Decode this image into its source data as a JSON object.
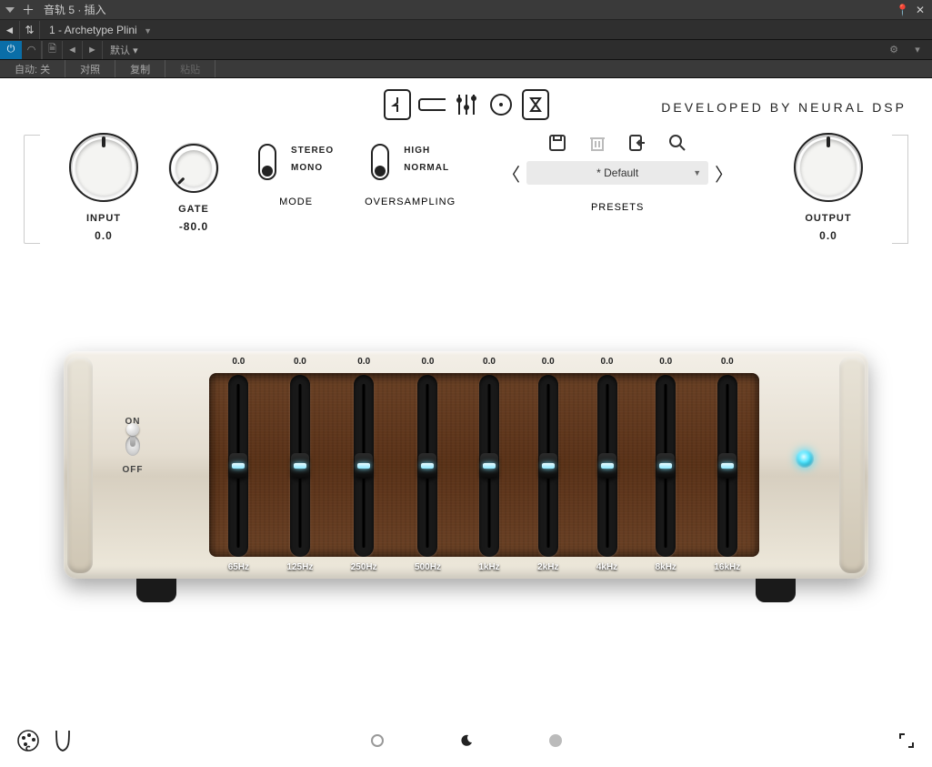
{
  "host": {
    "window_title": "音轨 5 · 插入",
    "plugin_name": "1 - Archetype Plini",
    "preset_default": "默认",
    "auto_label": "自动: 关",
    "tabs": {
      "compare": "对照",
      "copy": "复制",
      "paste": "粘贴"
    }
  },
  "header": {
    "developed_by": "DEVELOPED BY NEURAL DSP"
  },
  "controls": {
    "input": {
      "label": "INPUT",
      "value": "0.0"
    },
    "gate": {
      "label": "GATE",
      "value": "-80.0"
    },
    "mode": {
      "label": "MODE",
      "opt_top": "STEREO",
      "opt_bot": "MONO"
    },
    "oversampling": {
      "label": "OVERSAMPLING",
      "opt_top": "HIGH",
      "opt_bot": "NORMAL"
    },
    "presets": {
      "label": "PRESETS",
      "current": "* Default"
    },
    "output": {
      "label": "OUTPUT",
      "value": "0.0"
    }
  },
  "eq": {
    "on": "ON",
    "off": "OFF",
    "bands": [
      {
        "freq": "65Hz",
        "value": "0.0"
      },
      {
        "freq": "125Hz",
        "value": "0.0"
      },
      {
        "freq": "250Hz",
        "value": "0.0"
      },
      {
        "freq": "500Hz",
        "value": "0.0"
      },
      {
        "freq": "1kHz",
        "value": "0.0"
      },
      {
        "freq": "2kHz",
        "value": "0.0"
      },
      {
        "freq": "4kHz",
        "value": "0.0"
      },
      {
        "freq": "8kHz",
        "value": "0.0"
      },
      {
        "freq": "16kHz",
        "value": "0.0"
      }
    ]
  }
}
